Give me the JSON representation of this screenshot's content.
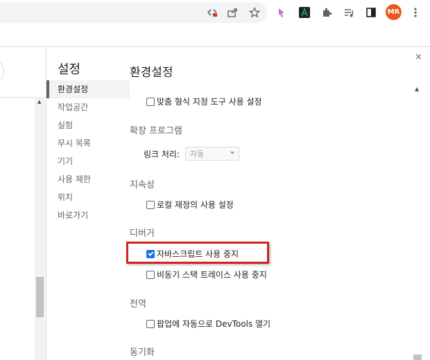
{
  "browser": {
    "icons": [
      "screen-capture-icon",
      "share-icon",
      "star-icon",
      "extension-arrow-icon",
      "extension-a-icon",
      "puzzle-icon",
      "playlist-icon",
      "sidepanel-icon",
      "menu-icon"
    ],
    "avatar_initials": "MR",
    "avatar_color": "#e8591a"
  },
  "sidebar": {
    "title": "설정",
    "items": [
      {
        "label": "환경설정",
        "active": true
      },
      {
        "label": "작업공간",
        "active": false
      },
      {
        "label": "실험",
        "active": false
      },
      {
        "label": "무시 목록",
        "active": false
      },
      {
        "label": "기기",
        "active": false
      },
      {
        "label": "사용 제한",
        "active": false
      },
      {
        "label": "위치",
        "active": false
      },
      {
        "label": "바로가기",
        "active": false
      }
    ]
  },
  "main": {
    "title": "환경설정",
    "close_label": "×",
    "sections": {
      "top_cut": "맞춤 형식 지정 도구 사용 설정",
      "extensions": {
        "title": "확장 프로그램",
        "link_label": "링크 처리:",
        "link_value": "자동"
      },
      "persistence": {
        "title": "지속성",
        "option": "로컬 재정의 사용 설정"
      },
      "debugger": {
        "title": "디버거",
        "options": [
          {
            "label": "자바스크립트 사용 중지",
            "checked": true
          },
          {
            "label": "비동기 스택 트레이스 사용 중지",
            "checked": false
          }
        ]
      },
      "global": {
        "title": "전역",
        "option": "팝업에 자동으로 DevTools 열기"
      },
      "sync": {
        "title": "동기화"
      }
    }
  },
  "colors": {
    "highlight": "#d21f1f",
    "checkbox_checked": "#1a73e8"
  }
}
